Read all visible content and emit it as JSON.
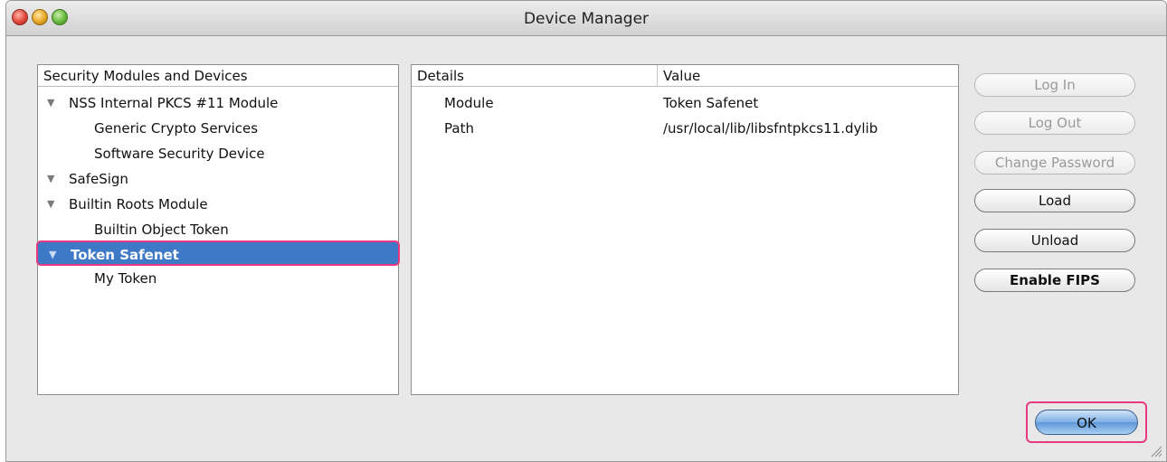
{
  "window": {
    "title": "Device Manager"
  },
  "tree": {
    "header": "Security Modules and Devices",
    "rows": [
      {
        "label": "NSS Internal PKCS #11 Module",
        "level": 0,
        "expanded": true,
        "selected": false
      },
      {
        "label": "Generic Crypto Services",
        "level": 1,
        "selected": false
      },
      {
        "label": "Software Security Device",
        "level": 1,
        "selected": false
      },
      {
        "label": "SafeSign",
        "level": 0,
        "expanded": true,
        "selected": false
      },
      {
        "label": "Builtin Roots Module",
        "level": 0,
        "expanded": true,
        "selected": false
      },
      {
        "label": "Builtin Object Token",
        "level": 1,
        "selected": false
      },
      {
        "label": "Token Safenet",
        "level": 0,
        "expanded": true,
        "selected": true
      },
      {
        "label": "My Token",
        "level": 1,
        "selected": false
      }
    ]
  },
  "details": {
    "headers": {
      "details": "Details",
      "value": "Value"
    },
    "rows": [
      {
        "key": "Module",
        "value": "Token Safenet"
      },
      {
        "key": "Path",
        "value": "/usr/local/lib/libsfntpkcs11.dylib"
      }
    ]
  },
  "buttons": {
    "log_in": "Log In",
    "log_out": "Log Out",
    "change_password": "Change Password",
    "load": "Load",
    "unload": "Unload",
    "enable_fips": "Enable FIPS",
    "ok": "OK"
  },
  "colors": {
    "selection": "#3d79c7",
    "highlight": "#e8397f"
  }
}
